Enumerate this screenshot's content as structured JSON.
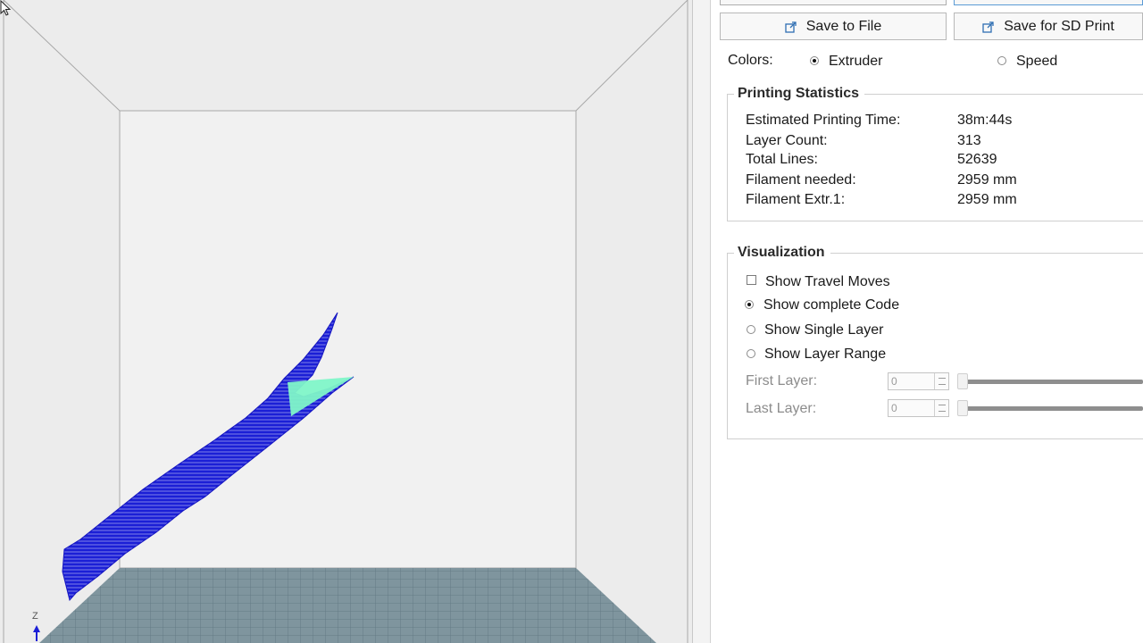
{
  "viewport": {
    "axis_label": "Z",
    "colors": {
      "background": "#ececec",
      "bed": "#7f959e",
      "model": "#1b1fd6",
      "highlight": "#7ff5c8",
      "frame": "#a8a8a8"
    }
  },
  "toolbar": {
    "save_file_label": "Save to File",
    "save_sd_label": "Save for SD Print"
  },
  "colors_option": {
    "label": "Colors:",
    "extruder_label": "Extruder",
    "speed_label": "Speed",
    "selected": "extruder"
  },
  "stats": {
    "title": "Printing Statistics",
    "rows": [
      {
        "label": "Estimated Printing Time:",
        "value": "38m:44s"
      },
      {
        "label": "Layer Count:",
        "value": "313"
      },
      {
        "label": "Total Lines:",
        "value": "52639"
      },
      {
        "label": "Filament needed:",
        "value": "2959 mm"
      },
      {
        "label": "Filament Extr.1:",
        "value": "2959 mm"
      }
    ]
  },
  "visualization": {
    "title": "Visualization",
    "show_travel_label": "Show Travel Moves",
    "show_complete_label": "Show complete Code",
    "show_single_label": "Show Single Layer",
    "show_range_label": "Show Layer Range",
    "selected": "complete",
    "first_layer_label": "First Layer:",
    "first_layer_value": "0",
    "last_layer_label": "Last Layer:",
    "last_layer_value": "0"
  }
}
